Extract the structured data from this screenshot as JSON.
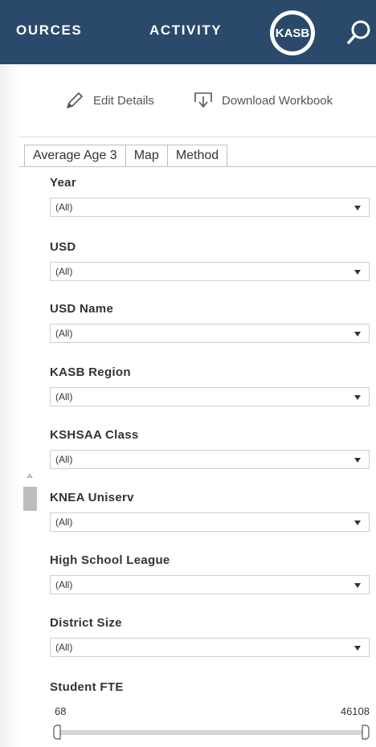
{
  "nav": {
    "items": [
      "OURCES",
      "ACTIVITY"
    ],
    "logo_text": "KASB",
    "colors": {
      "bar": "#2b4a6b",
      "text": "#ffffff"
    }
  },
  "toolbar": {
    "edit_label": "Edit Details",
    "download_label": "Download Workbook",
    "icons": [
      "pencil-icon",
      "download-icon"
    ]
  },
  "tabs": [
    "Average Age 3",
    "Map",
    "Method"
  ],
  "filters": [
    {
      "label": "Year",
      "value": "(All)"
    },
    {
      "label": "USD",
      "value": "(All)"
    },
    {
      "label": "USD Name",
      "value": "(All)"
    },
    {
      "label": "KASB Region",
      "value": "(All)"
    },
    {
      "label": "KSHSAA Class",
      "value": "(All)"
    },
    {
      "label": "KNEA Uniserv",
      "value": "(All)"
    },
    {
      "label": "High School League",
      "value": "(All)"
    },
    {
      "label": "District Size",
      "value": "(All)"
    }
  ],
  "slider": {
    "label": "Student FTE",
    "min": "68",
    "max": "46108"
  }
}
